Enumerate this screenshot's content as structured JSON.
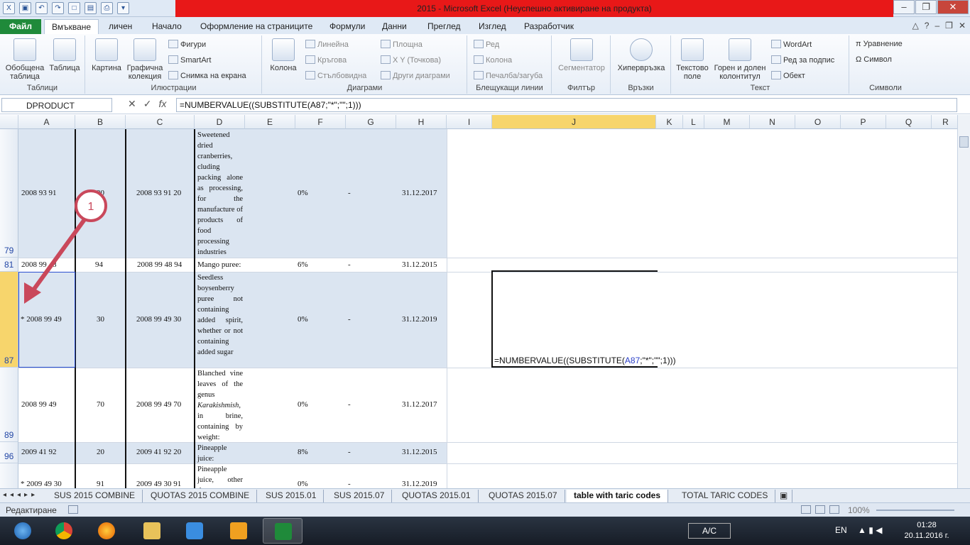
{
  "window": {
    "title": "2015  -  Microsoft Excel (Неуспешно активиране на продукта)"
  },
  "ribbon_tabs": [
    "Файл",
    "Вмъкване",
    "личен",
    "Начало",
    "Оформление на страниците",
    "Формули",
    "Данни",
    "Преглед",
    "Изглед",
    "Разработчик"
  ],
  "ribbon": {
    "groups": {
      "tables": "Таблици",
      "illustrations": "Илюстрации",
      "charts": "Диаграми",
      "sparklines": "Блещукащи линии",
      "filter": "Филтър",
      "links": "Връзки",
      "text": "Текст",
      "symbols": "Символи"
    },
    "buttons": {
      "pivot": "Обобщена таблица",
      "table": "Таблица",
      "picture": "Картина",
      "clipart": "Графична колекция",
      "shapes": "Фигури",
      "smartart": "SmartArt",
      "screenshot": "Снимка на екрана",
      "column": "Колона",
      "line": "Линейна",
      "pie": "Кръгова",
      "bar": "Стълбовидна",
      "area": "Площна",
      "scatter": "X Y (Точкова)",
      "other": "Други диаграми",
      "spark_line": "Ред",
      "spark_column": "Колона",
      "spark_winloss": "Печалба/загуба",
      "slicer": "Сегментатор",
      "hyperlink": "Хипервръзка",
      "textbox": "Текстово поле",
      "headerfooter": "Горен и долен колонтитул",
      "wordart": "WordArt",
      "signature": "Ред за подпис",
      "object": "Обект",
      "equation": "Уравнение",
      "symbol": "Символ"
    }
  },
  "formula_bar": {
    "name_box": "DPRODUCT",
    "formula": "=NUMBERVALUE((SUBSTITUTE(A87;\"*\";\"\";1)))"
  },
  "columns": [
    "A",
    "B",
    "C",
    "D",
    "E",
    "F",
    "G",
    "H",
    "I",
    "J",
    "K",
    "L",
    "M",
    "N",
    "O",
    "P",
    "Q",
    "R"
  ],
  "rows": [
    {
      "num": "79",
      "a": "2008 93 91",
      "b": "20",
      "c": "2008 93 91 20",
      "d": "Sweetened dried cranberries, cluding packing alone as processing, for the manufacture of products of food processing industries",
      "f": "0%",
      "g": "-",
      "h": "31.12.2017"
    },
    {
      "num": "81",
      "a": "2008 99 48",
      "b": "94",
      "c": "2008 99 48 94",
      "d": "Mango puree:",
      "f": "6%",
      "g": "-",
      "h": "31.12.2015"
    },
    {
      "num": "87",
      "a": "* 2008 99 49",
      "b": "30",
      "c": "2008 99 49 30",
      "d": "Seedless boysenberry puree not containing added spirit, whether or not containing added sugar",
      "f": "0%",
      "g": "-",
      "h": "31.12.2019"
    },
    {
      "num": "89",
      "a": "2008 99 49",
      "b": "70",
      "c": "2008 99 49 70",
      "d_pre": "Blanched vine leaves of the genus ",
      "d_ital": "Karakishmish",
      "d_post": ", in brine, containing by weight:",
      "f": "0%",
      "g": "-",
      "h": "31.12.2017"
    },
    {
      "num": "96",
      "a": "2009 41 92",
      "b": "20",
      "c": "2009 41 92 20",
      "d": "Pineapple juice:",
      "f": "8%",
      "g": "-",
      "h": "31.12.2015"
    },
    {
      "num": "",
      "a": "* 2009 49 30",
      "b": "91",
      "c": "2009 49 30 91",
      "d": "Pineapple juice, other than",
      "f": "0%",
      "g": "-",
      "h": "31.12.2019"
    }
  ],
  "edit_cell": {
    "pre": "=NUMBERVALUE((SUBSTITUTE(",
    "ref": "A87",
    "post": ";\"*\";\"\";1)))"
  },
  "annotation": {
    "label": "1"
  },
  "sheet_tabs": [
    "SUS 2015 COMBINE",
    "QUOTAS 2015 COMBINE",
    "SUS 2015.01",
    "SUS 2015.07",
    "QUOTAS 2015.01",
    "QUOTAS 2015.07",
    "table with taric codes",
    "TOTAL TARIC CODES"
  ],
  "active_sheet": "table with taric codes",
  "status": {
    "mode": "Редактиране",
    "zoom": "100%"
  },
  "taskbar": {
    "keyboard": "A/C",
    "lang": "EN",
    "time": "01:28",
    "date": "20.11.2016 г."
  },
  "colors": {
    "accent_file": "#1f8a3a",
    "title_red": "#e81818",
    "selected_header": "#f7d56c",
    "row_shade": "#dbe5f1"
  }
}
